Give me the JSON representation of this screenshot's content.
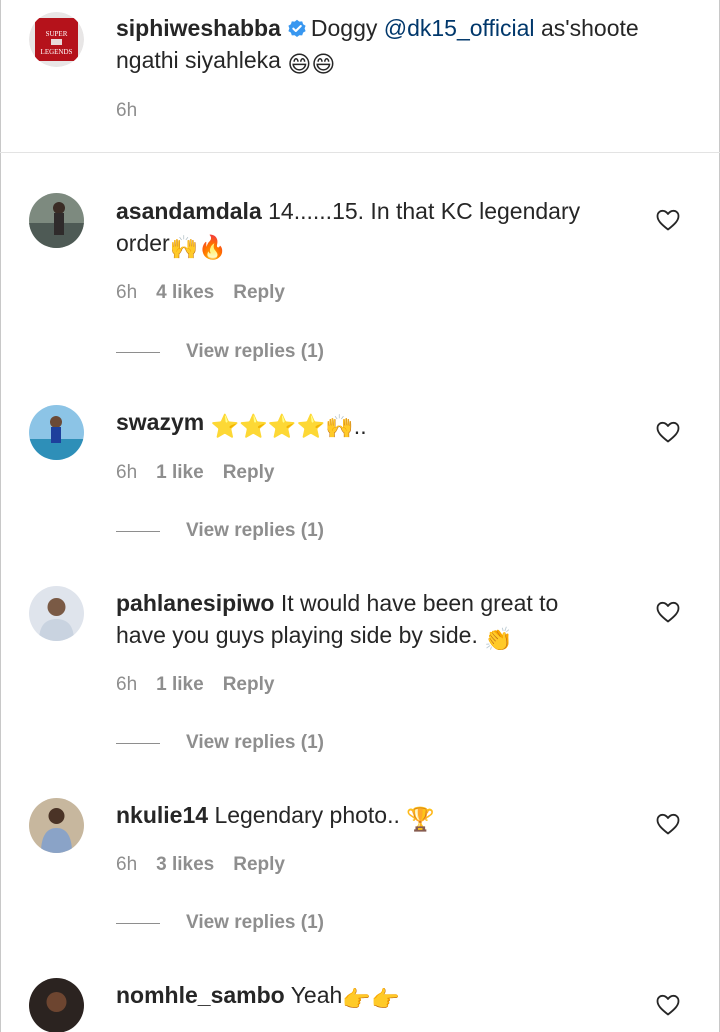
{
  "caption": {
    "username": "siphiweshabba",
    "verified": true,
    "text_before": "Doggy",
    "mention": "@dk15_official",
    "text_after": "as'shoote",
    "text_line2": "ngathi siyahleka",
    "emoji": "😄😄",
    "time": "6h",
    "avatar_text_top": "SUPER",
    "avatar_text_bottom": "LEGENDS"
  },
  "comments": [
    {
      "username": "asandamdala",
      "text": "14......15. In that KC legendary",
      "text_line2": "order",
      "emoji": "🙌🔥",
      "time": "6h",
      "likes": "4 likes",
      "reply": "Reply",
      "view_replies": "View replies (1)"
    },
    {
      "username": "swazym",
      "text": "",
      "emoji": "⭐⭐⭐⭐🙌..",
      "time": "6h",
      "likes": "1 like",
      "reply": "Reply",
      "view_replies": "View replies (1)"
    },
    {
      "username": "pahlanesipiwo",
      "text": "It would have been great to",
      "text_line2": "have you guys playing side by side.",
      "emoji": "👏",
      "time": "6h",
      "likes": "1 like",
      "reply": "Reply",
      "view_replies": "View replies (1)"
    },
    {
      "username": "nkulie14",
      "text": "Legendary photo..",
      "emoji": "🏆",
      "time": "6h",
      "likes": "3 likes",
      "reply": "Reply",
      "view_replies": "View replies (1)"
    },
    {
      "username": "nomhle_sambo",
      "text": "Yeah",
      "emoji": "👉👉",
      "time": "",
      "likes": "",
      "reply": "",
      "view_replies": ""
    }
  ],
  "colors": {
    "text": "#262626",
    "muted": "#8e8e8e",
    "mention": "#00376b",
    "verified": "#3897f0",
    "divider": "#e3e3e3"
  },
  "icons": {
    "verified": "verified-badge-icon",
    "like": "heart-outline-icon"
  }
}
